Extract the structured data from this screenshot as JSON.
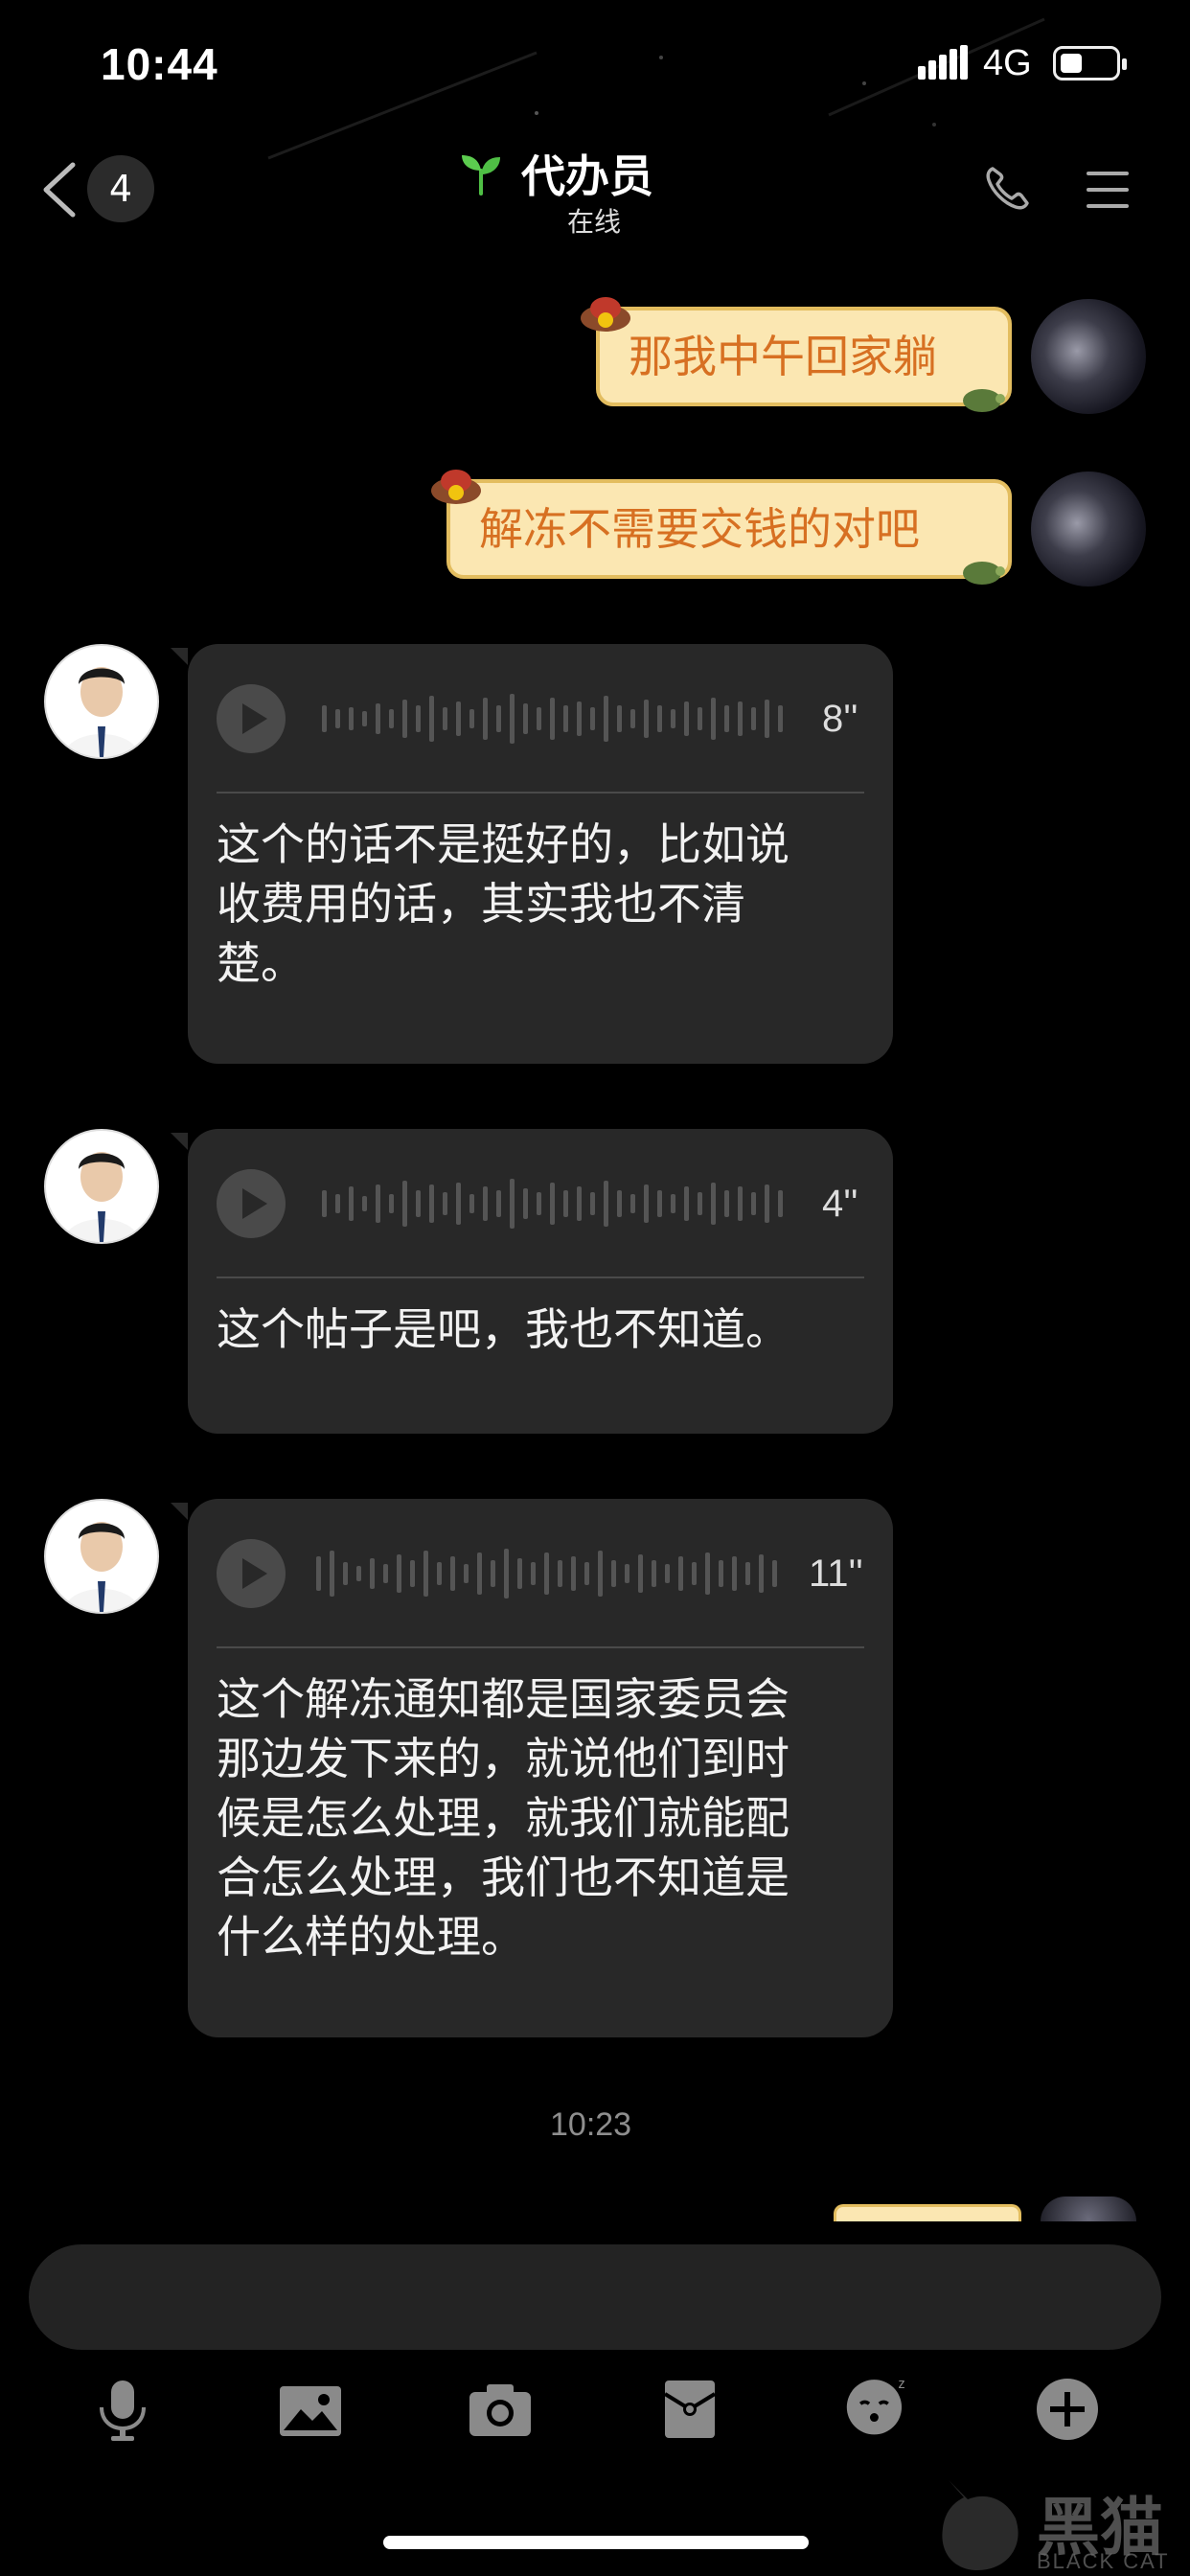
{
  "status_bar": {
    "time": "10:44",
    "network": "4G"
  },
  "header": {
    "back_count": "4",
    "title": "代办员",
    "subtitle": "在线"
  },
  "messages": [
    {
      "from": "me",
      "type": "text",
      "text": "那我中午回家躺"
    },
    {
      "from": "me",
      "type": "text",
      "text": "解冻不需要交钱的对吧"
    },
    {
      "from": "other",
      "type": "voice",
      "duration": "8''",
      "transcript": [
        "这个的话不是挺好的，比如说",
        "收费用的话，其实我也不清",
        "楚。"
      ]
    },
    {
      "from": "other",
      "type": "voice",
      "duration": "4''",
      "transcript": [
        "这个帖子是吧，我也不知道。"
      ]
    },
    {
      "from": "other",
      "type": "voice",
      "duration": "11''",
      "transcript": [
        "这个解冻通知都是国家委员会",
        "那边发下来的，就说他们到时",
        "候是怎么处理，就我们就能配",
        "合怎么处理，我们也不知道是",
        "什么样的处理。"
      ]
    }
  ],
  "timestamp": "10:23",
  "toolbar": [
    "microphone-icon",
    "image-icon",
    "camera-icon",
    "red-packet-icon",
    "emoji-icon",
    "plus-icon"
  ],
  "watermark": {
    "text": "黑猫",
    "sub": "BLACK CAT"
  },
  "colors": {
    "background": "#000000",
    "my_bubble": "#fbe7b2",
    "my_bubble_border": "#e3bd5f",
    "my_text": "#d77022",
    "voice_bubble": "#282828",
    "input_bar": "#232323"
  }
}
